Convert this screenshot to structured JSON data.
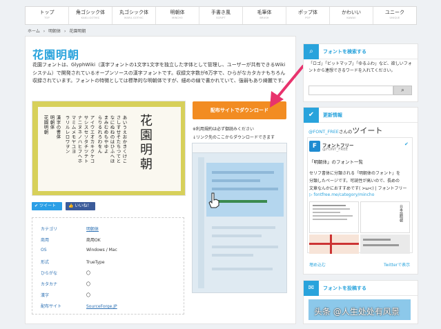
{
  "nav": [
    {
      "ja": "トップ",
      "en": "TOP"
    },
    {
      "ja": "角ゴシック体",
      "en": "KAKU-GOTHIC"
    },
    {
      "ja": "丸ゴシック体",
      "en": "MARU-GOTHIC"
    },
    {
      "ja": "明朝体",
      "en": "MINCHO"
    },
    {
      "ja": "手書き風",
      "en": "SCRIPT"
    },
    {
      "ja": "毛筆体",
      "en": "BRUSH"
    },
    {
      "ja": "ポップ体",
      "en": "POP"
    },
    {
      "ja": "かわいい",
      "en": "KAWAII"
    },
    {
      "ja": "ユニーク",
      "en": "UNIQUE"
    }
  ],
  "breadcrumb": {
    "home": "ホーム",
    "sep": "›",
    "cat": "明朝体",
    "current": "花園明朝"
  },
  "main": {
    "title": "花園明朝",
    "description": "花園フォントは、GlyphWiki（漢字フォントの1文字1文字を独立した字体として管理し、ユーザーが共有できるWikiシステム）で開発されているオープンソースの漢字フォントです。収録文字数が6万字で、ひらがなカタカナもちろん収録されています。フォントの特徴としては標準的な明朝体ですが、細めの線で書かれていて、強弱もあり綺麗です。",
    "sample": {
      "title": "花園明朝",
      "lines": [
        "あいうえおかきくけこ",
        "さしすせそたちつてと",
        "なにぬねのはひふへほ",
        "まみむめもやゆよ",
        "らりるれろわをん",
        "アイウエオカキクケコ",
        "サシスセソタチツテト",
        "ナニヌネノハヒフヘホ",
        "マミムメモヤユヨ",
        "ラリルレロワヲン",
        "漢字の書体",
        "明朝体",
        "花園明朝"
      ]
    },
    "download_label": "配布サイトでダウンロード",
    "note1": "※利用規約は必ず御読みください",
    "note2": "↓リンク先のここからダウンロードできます",
    "tweet_button": "ツイート",
    "like_button": "いいね！",
    "info": [
      {
        "k": "カテゴリ",
        "v": "明朝体",
        "link": true
      },
      {
        "k": "商用",
        "v": "商用OK",
        "link": false
      },
      {
        "k": "OS",
        "v": "Windows / Mac",
        "link": false
      },
      {
        "k": "形式",
        "v": "TrueType",
        "link": false
      },
      {
        "k": "ひらがな",
        "v": "〇",
        "link": false
      },
      {
        "k": "カタカナ",
        "v": "〇",
        "link": false
      },
      {
        "k": "漢字",
        "v": "〇",
        "link": false
      },
      {
        "k": "配布サイト",
        "v": "SourceForge.JP",
        "link": true
      }
    ]
  },
  "sidebar": {
    "search_title": "フォントを検索する",
    "search_note": "「ロゴ」「ビットマップ」「ゆるふわ」など、欲しいフォントから連想できるワードを入れてください。",
    "search_placeholder": "",
    "update_title": "更新情報",
    "tweets_prefix": "@FONT_FREE",
    "tweets_mid": "さんの",
    "tweets_word": "ツイート",
    "account_name": "フォントフリー",
    "account_handle": "@FONT_FREE",
    "tweet_text1": "「明朝体」のフォント一覧",
    "tweet_text2": "セリフ書体に分類される「明朝体のフォント」を",
    "tweet_text3": "分類したページです。可読性が高いので、長めの",
    "tweet_text4": "文章なんかにおすすめです( >ω<) | フォントフリー",
    "tweet_link": "▷ fontfree.me/category/mincho",
    "thumb2_label": "日本語明朝",
    "embed": "埋め込む",
    "view_twitter": "Twitterで表示",
    "post_title": "フォントを投稿する"
  },
  "watermark": "头条 @人生处处有风景",
  "colors": {
    "accent": "#29a3dc",
    "download": "#f28c22",
    "arrow": "#e8336d",
    "twitter": "#2b9fe6",
    "facebook": "#3b5b9a"
  }
}
